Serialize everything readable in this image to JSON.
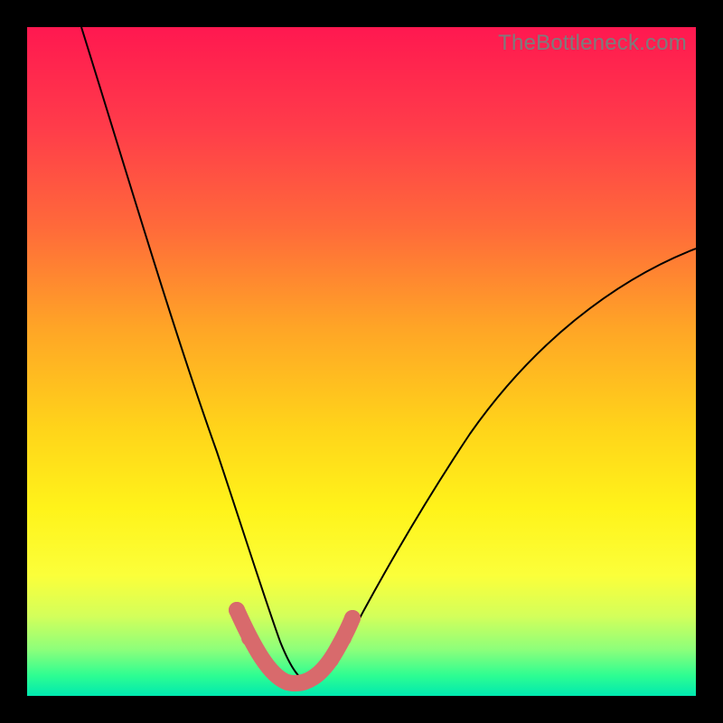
{
  "watermark": "TheBottleneck.com",
  "chart_data": {
    "type": "line",
    "title": "",
    "xlabel": "",
    "ylabel": "",
    "xlim": [
      0,
      100
    ],
    "ylim": [
      0,
      100
    ],
    "x": [
      8,
      12,
      16,
      20,
      24,
      27,
      30,
      32,
      34,
      36,
      38,
      40,
      42,
      44,
      46,
      50,
      55,
      60,
      65,
      70,
      75,
      80,
      85,
      90,
      95,
      100
    ],
    "y": [
      100,
      85,
      71,
      58,
      46,
      37,
      28,
      21,
      15,
      9,
      5,
      3,
      2,
      3,
      6,
      12,
      21,
      29,
      36,
      42,
      48,
      53,
      57,
      61,
      64,
      67
    ],
    "note": "Values estimated from pixel positions; y=0 at bottom, x=0 at left."
  },
  "marker_region": {
    "x_start": 30,
    "x_end": 46,
    "dots_x": [
      30,
      32,
      43,
      45,
      46
    ]
  },
  "colors": {
    "gradient_top": "#ff1850",
    "gradient_bottom": "#00e9b0",
    "curve": "#000000",
    "marker": "#d86a6c",
    "watermark": "#7c7c7c",
    "frame": "#000000"
  }
}
